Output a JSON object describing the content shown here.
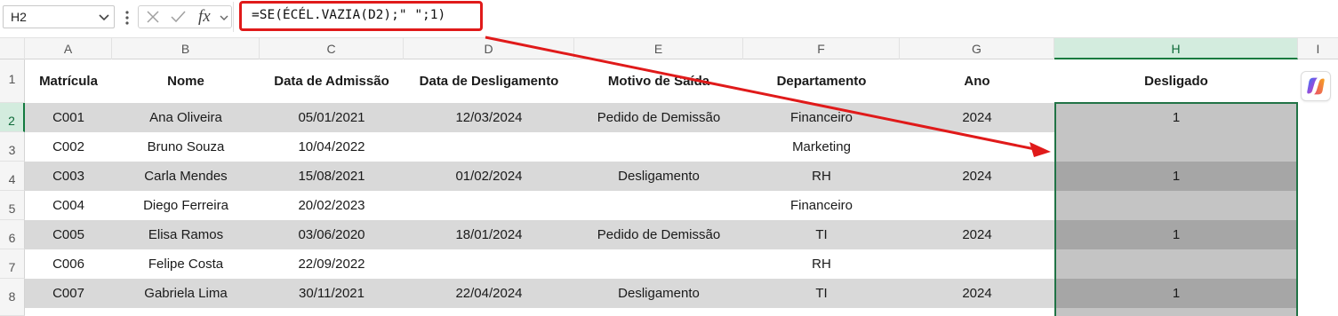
{
  "formula_bar": {
    "name_box": "H2",
    "fx_label": "fx",
    "formula": "=SE(ÉCÉL.VAZIA(D2);\" \";1)"
  },
  "columns": [
    "A",
    "B",
    "C",
    "D",
    "E",
    "F",
    "G",
    "H",
    "I"
  ],
  "rows": [
    "1",
    "2",
    "3",
    "4",
    "5",
    "6",
    "7",
    "8"
  ],
  "table": {
    "headers": [
      "Matrícula",
      "Nome",
      "Data de Admissão",
      "Data de Desligamento",
      "Motivo de Saída",
      "Departamento",
      "Ano",
      "Desligado"
    ],
    "rows": [
      [
        "C001",
        "Ana Oliveira",
        "05/01/2021",
        "12/03/2024",
        "Pedido de Demissão",
        "Financeiro",
        "2024",
        "1"
      ],
      [
        "C002",
        "Bruno Souza",
        "10/04/2022",
        "",
        "",
        "Marketing",
        "",
        ""
      ],
      [
        "C003",
        "Carla Mendes",
        "15/08/2021",
        "01/02/2024",
        "Desligamento",
        "RH",
        "2024",
        "1"
      ],
      [
        "C004",
        "Diego Ferreira",
        "20/02/2023",
        "",
        "",
        "Financeiro",
        "",
        ""
      ],
      [
        "C005",
        "Elisa Ramos",
        "03/06/2020",
        "18/01/2024",
        "Pedido de Demissão",
        "TI",
        "2024",
        "1"
      ],
      [
        "C006",
        "Felipe Costa",
        "22/09/2022",
        "",
        "",
        "RH",
        "",
        ""
      ],
      [
        "C007",
        "Gabriela Lima",
        "30/11/2021",
        "22/04/2024",
        "Desligamento",
        "TI",
        "2024",
        "1"
      ]
    ]
  },
  "colors": {
    "band_gray": "#d9d9d9",
    "h_light": "#c4c4c4",
    "h_dark": "#a6a6a6",
    "annotation_red": "#e01a1a",
    "selection_green": "#217346"
  },
  "icons": {
    "copilot": "copilot-icon",
    "cancel": "cancel-x-icon",
    "enter": "enter-check-icon"
  }
}
